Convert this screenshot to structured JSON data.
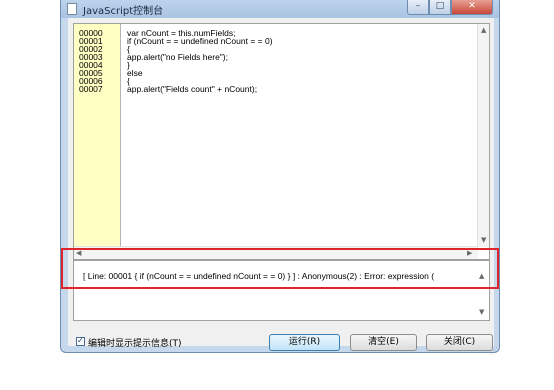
{
  "window": {
    "title": "JavaScript控制台",
    "controls": {
      "minimize": "–",
      "maximize": "□",
      "close": "✕"
    }
  },
  "editor": {
    "line_numbers": [
      "00000",
      "00001",
      "00002",
      "00003",
      "00004",
      "00005",
      "00006",
      "00007"
    ],
    "code_lines": [
      "var nCount = this.numFields;",
      "if (nCount = = undefined nCount = = 0)",
      "{",
      "app.alert(\"no Fields here\");",
      "}",
      "else",
      "{",
      "app.alert(\"Fields count\" + nCount);"
    ]
  },
  "output": {
    "text": "[ Line: 00001 { if (nCount = = undefined nCount = = 0) } ] : Anonymous(2) : Error: expression ("
  },
  "footer": {
    "checkbox_label": "编辑时显示提示信息(T)",
    "checkbox_checked": true,
    "run_label": "运行(R)",
    "clear_label": "清空(E)",
    "close_label": "关闭(C)"
  }
}
